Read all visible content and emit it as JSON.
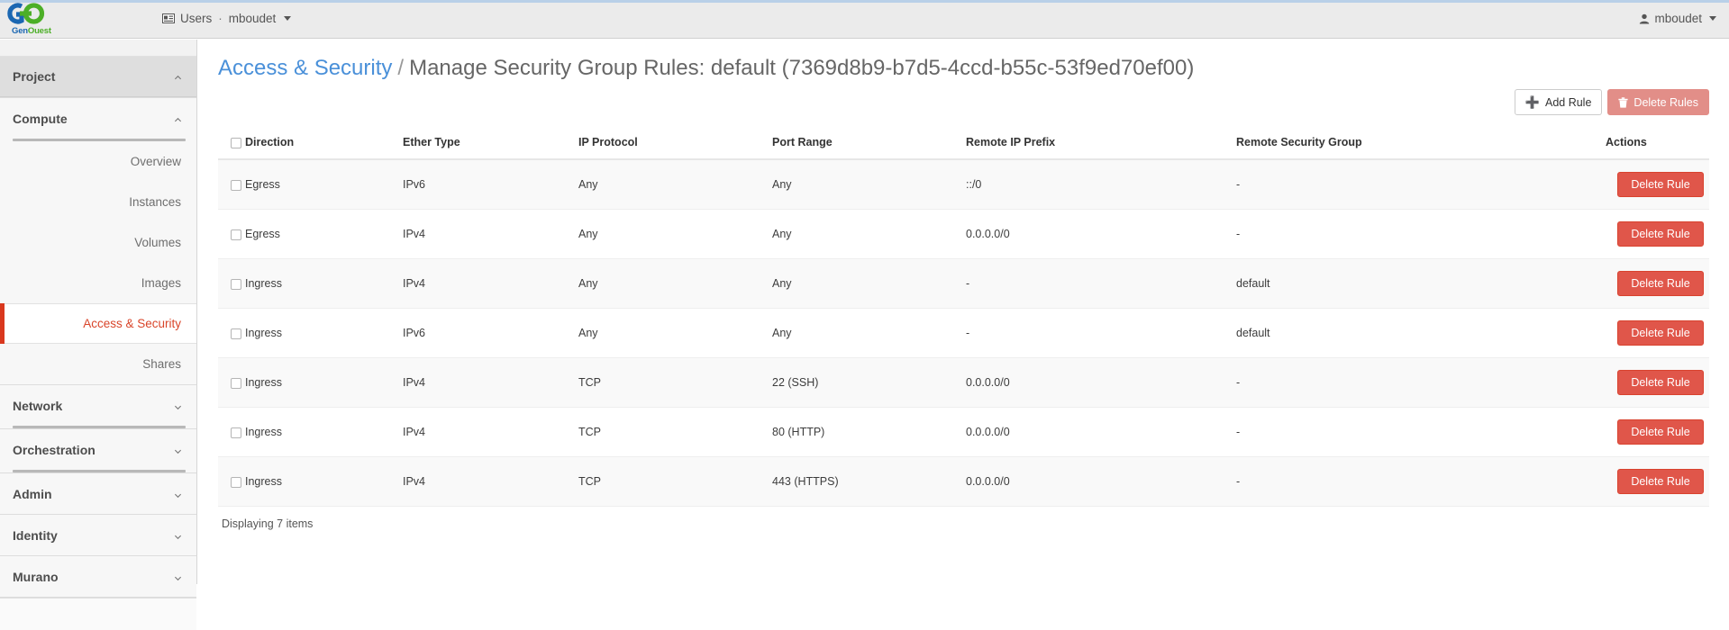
{
  "topbar": {
    "brand": {
      "logo_icon": "genouest-go-logo",
      "name_part1": "Gen",
      "name_part2": "Ouest"
    },
    "context_switcher": {
      "icon": "id-card-icon",
      "scope_label": "Users",
      "separator": "·",
      "project_label": "mboudet"
    },
    "user_menu": {
      "icon": "user-icon",
      "username": "mboudet"
    },
    "accent_color": "#b9d0e8"
  },
  "sidebar": {
    "panels": [
      {
        "label": "Project",
        "state": "expanded",
        "chevron": "chevron-up-icon",
        "level": "top"
      },
      {
        "label": "Compute",
        "state": "expanded",
        "chevron": "chevron-up-icon",
        "level": "section",
        "items": [
          {
            "label": "Overview",
            "active": false
          },
          {
            "label": "Instances",
            "active": false
          },
          {
            "label": "Volumes",
            "active": false
          },
          {
            "label": "Images",
            "active": false
          },
          {
            "label": "Access & Security",
            "active": true
          },
          {
            "label": "Shares",
            "active": false
          }
        ]
      },
      {
        "label": "Network",
        "state": "collapsed",
        "chevron": "chevron-down-icon",
        "level": "section"
      },
      {
        "label": "Orchestration",
        "state": "collapsed",
        "chevron": "chevron-down-icon",
        "level": "section"
      },
      {
        "label": "Admin",
        "state": "collapsed",
        "chevron": "chevron-down-icon",
        "level": "top-plain"
      },
      {
        "label": "Identity",
        "state": "collapsed",
        "chevron": "chevron-down-icon",
        "level": "top-plain"
      },
      {
        "label": "Murano",
        "state": "collapsed",
        "chevron": "chevron-down-icon",
        "level": "top-plain"
      }
    ],
    "active_color": "#d9452a"
  },
  "page": {
    "breadcrumb_link": "Access & Security",
    "breadcrumb_separator": "/",
    "title": "Manage Security Group Rules: default (7369d8b9-b7d5-4ccd-b55c-53f9ed70ef00)"
  },
  "actions": {
    "add_rule": {
      "label": "Add Rule",
      "icon": "plus-icon"
    },
    "delete_rules": {
      "label": "Delete Rules",
      "icon": "trash-icon",
      "disabled": true
    }
  },
  "table": {
    "columns": [
      "Direction",
      "Ether Type",
      "IP Protocol",
      "Port Range",
      "Remote IP Prefix",
      "Remote Security Group",
      "Actions"
    ],
    "row_action_label": "Delete Rule",
    "rows": [
      {
        "direction": "Egress",
        "ether_type": "IPv6",
        "ip_protocol": "Any",
        "port_range": "Any",
        "remote_ip_prefix": "::/0",
        "remote_security_group": "-"
      },
      {
        "direction": "Egress",
        "ether_type": "IPv4",
        "ip_protocol": "Any",
        "port_range": "Any",
        "remote_ip_prefix": "0.0.0.0/0",
        "remote_security_group": "-"
      },
      {
        "direction": "Ingress",
        "ether_type": "IPv4",
        "ip_protocol": "Any",
        "port_range": "Any",
        "remote_ip_prefix": "-",
        "remote_security_group": "default"
      },
      {
        "direction": "Ingress",
        "ether_type": "IPv6",
        "ip_protocol": "Any",
        "port_range": "Any",
        "remote_ip_prefix": "-",
        "remote_security_group": "default"
      },
      {
        "direction": "Ingress",
        "ether_type": "IPv4",
        "ip_protocol": "TCP",
        "port_range": "22 (SSH)",
        "remote_ip_prefix": "0.0.0.0/0",
        "remote_security_group": "-"
      },
      {
        "direction": "Ingress",
        "ether_type": "IPv4",
        "ip_protocol": "TCP",
        "port_range": "80 (HTTP)",
        "remote_ip_prefix": "0.0.0.0/0",
        "remote_security_group": "-"
      },
      {
        "direction": "Ingress",
        "ether_type": "IPv4",
        "ip_protocol": "TCP",
        "port_range": "443 (HTTPS)",
        "remote_ip_prefix": "0.0.0.0/0",
        "remote_security_group": "-"
      }
    ],
    "footer": "Displaying 7 items"
  },
  "colors": {
    "link": "#4a90d9",
    "danger": "#e0564a",
    "danger_muted": "#e28e88",
    "active_nav": "#d9452a"
  }
}
